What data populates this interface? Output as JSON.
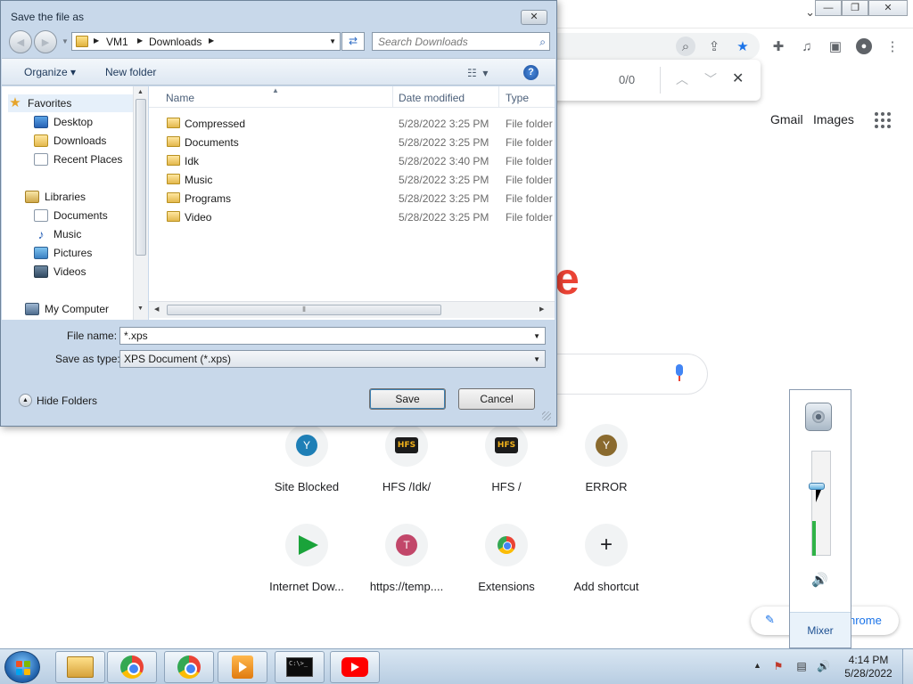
{
  "chrome": {
    "find": {
      "count": "0/0"
    },
    "header_links": [
      "Gmail",
      "Images"
    ],
    "logo_fragment": "e",
    "customize_label": "hrome",
    "shortcuts": [
      {
        "label": "Site Blocked",
        "icon": "letter",
        "letter": "Y",
        "color": "#1e7fb6"
      },
      {
        "label": "HFS /Idk/",
        "icon": "hfs-logo",
        "badge": "HFS"
      },
      {
        "label": "HFS /",
        "icon": "hfs-logo",
        "badge": "HFS"
      },
      {
        "label": "ERROR",
        "icon": "letter",
        "letter": "Y",
        "color": "#8a6a2e"
      },
      {
        "label": "Internet Dow...",
        "icon": "play-arrow"
      },
      {
        "label": "https://temp....",
        "icon": "letter",
        "letter": "T",
        "color": "#c2476a"
      },
      {
        "label": "Extensions",
        "icon": "chrome-logo"
      },
      {
        "label": "Add shortcut",
        "icon": "plus"
      }
    ]
  },
  "volume": {
    "mixer_label": "Mixer",
    "level_fraction": 0.33
  },
  "dialog": {
    "title": "Save the file as",
    "address": [
      "VM1",
      "Downloads"
    ],
    "search_placeholder": "Search Downloads",
    "organize_label": "Organize",
    "new_folder_label": "New folder",
    "nav": {
      "favorites": "Favorites",
      "favorites_items": [
        "Desktop",
        "Downloads",
        "Recent Places"
      ],
      "libraries": "Libraries",
      "libraries_items": [
        "Documents",
        "Music",
        "Pictures",
        "Videos"
      ],
      "computer": "My Computer"
    },
    "columns": {
      "name": "Name",
      "date": "Date modified",
      "type": "Type"
    },
    "files": [
      {
        "name": "Compressed",
        "date": "5/28/2022 3:25 PM",
        "type": "File folder"
      },
      {
        "name": "Documents",
        "date": "5/28/2022 3:25 PM",
        "type": "File folder"
      },
      {
        "name": "Idk",
        "date": "5/28/2022 3:40 PM",
        "type": "File folder"
      },
      {
        "name": "Music",
        "date": "5/28/2022 3:25 PM",
        "type": "File folder"
      },
      {
        "name": "Programs",
        "date": "5/28/2022 3:25 PM",
        "type": "File folder"
      },
      {
        "name": "Video",
        "date": "5/28/2022 3:25 PM",
        "type": "File folder"
      }
    ],
    "file_name_label": "File name:",
    "file_name_value": "*.xps",
    "save_type_label": "Save as type:",
    "save_type_value": "XPS Document (*.xps)",
    "hide_folders_label": "Hide Folders",
    "save_label": "Save",
    "cancel_label": "Cancel"
  },
  "taskbar": {
    "apps": [
      "windows-explorer",
      "google-chrome",
      "google-chrome",
      "media-player",
      "command-prompt",
      "youtube"
    ],
    "cmd_text": "C:\\>_",
    "time": "4:14 PM",
    "date": "5/28/2022"
  }
}
